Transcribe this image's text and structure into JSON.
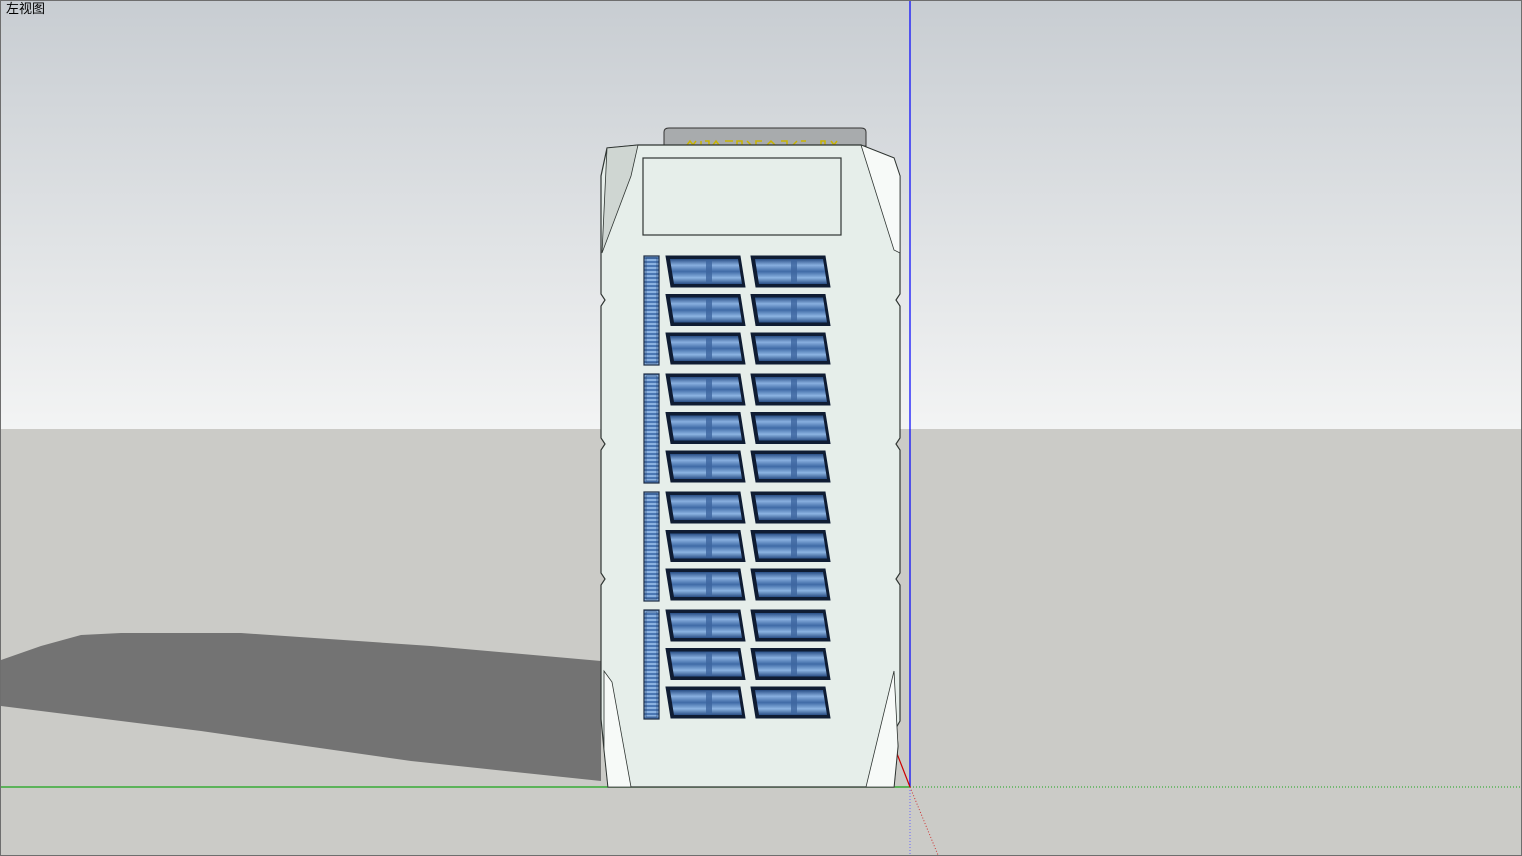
{
  "view": {
    "label": "左视图"
  },
  "colors": {
    "sky_top": "#c8cdd2",
    "sky_bottom": "#f3f4f4",
    "ground": "#cbcbc7",
    "shadow": "#737373",
    "building": "#e6eeea",
    "building_side": "#f5f8f6",
    "panel_dark": "#1c3358",
    "panel_light": "#86aede",
    "axis_blue": "#0000ff",
    "axis_green": "#00aa00",
    "axis_red": "#cc0000",
    "sign_text": "#c8b400"
  },
  "model": {
    "icon": "building-with-solar-panels",
    "panel_groups": 4,
    "rows_per_group": 3,
    "panels_per_row": 2
  }
}
